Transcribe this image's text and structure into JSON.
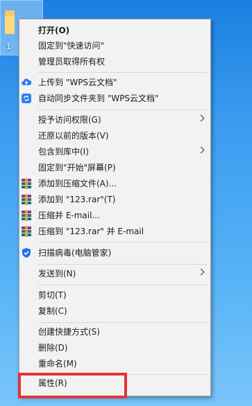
{
  "desktop": {
    "file_label": "1"
  },
  "menu": {
    "open": "打开(O)",
    "pin_quick_access": "固定到\"快速访问\"",
    "take_ownership": "管理员取得所有权",
    "upload_wps": "上传到 \"WPS云文档\"",
    "auto_sync_wps": "自动同步文件夹到 \"WPS云文档\"",
    "grant_access": "授予访问权限(G)",
    "restore_versions": "还原以前的版本(V)",
    "include_library": "包含到库中(I)",
    "pin_start": "固定到\"开始\"屏幕(P)",
    "add_to_archive": "添加到压缩文件(A)...",
    "add_to_rar": "添加到 \"123.rar\"(T)",
    "compress_email": "压缩并 E-mail...",
    "compress_rar_email": "压缩到 \"123.rar\" 并 E-mail",
    "scan_virus": "扫描病毒(电脑管家)",
    "send_to": "发送到(N)",
    "cut": "剪切(T)",
    "copy": "复制(C)",
    "create_shortcut": "创建快捷方式(S)",
    "delete": "删除(D)",
    "rename": "重命名(M)",
    "properties": "属性(R)"
  },
  "colors": {
    "highlight": "#e53238",
    "wps_blue": "#2f7ef0",
    "shield_blue": "#1a73e8"
  },
  "icons": {
    "wps_upload": "cloud-upload-icon",
    "wps_sync": "cloud-sync-icon",
    "winrar": "winrar-books-icon",
    "shield": "shield-icon",
    "submenu": "chevron-right-icon"
  }
}
